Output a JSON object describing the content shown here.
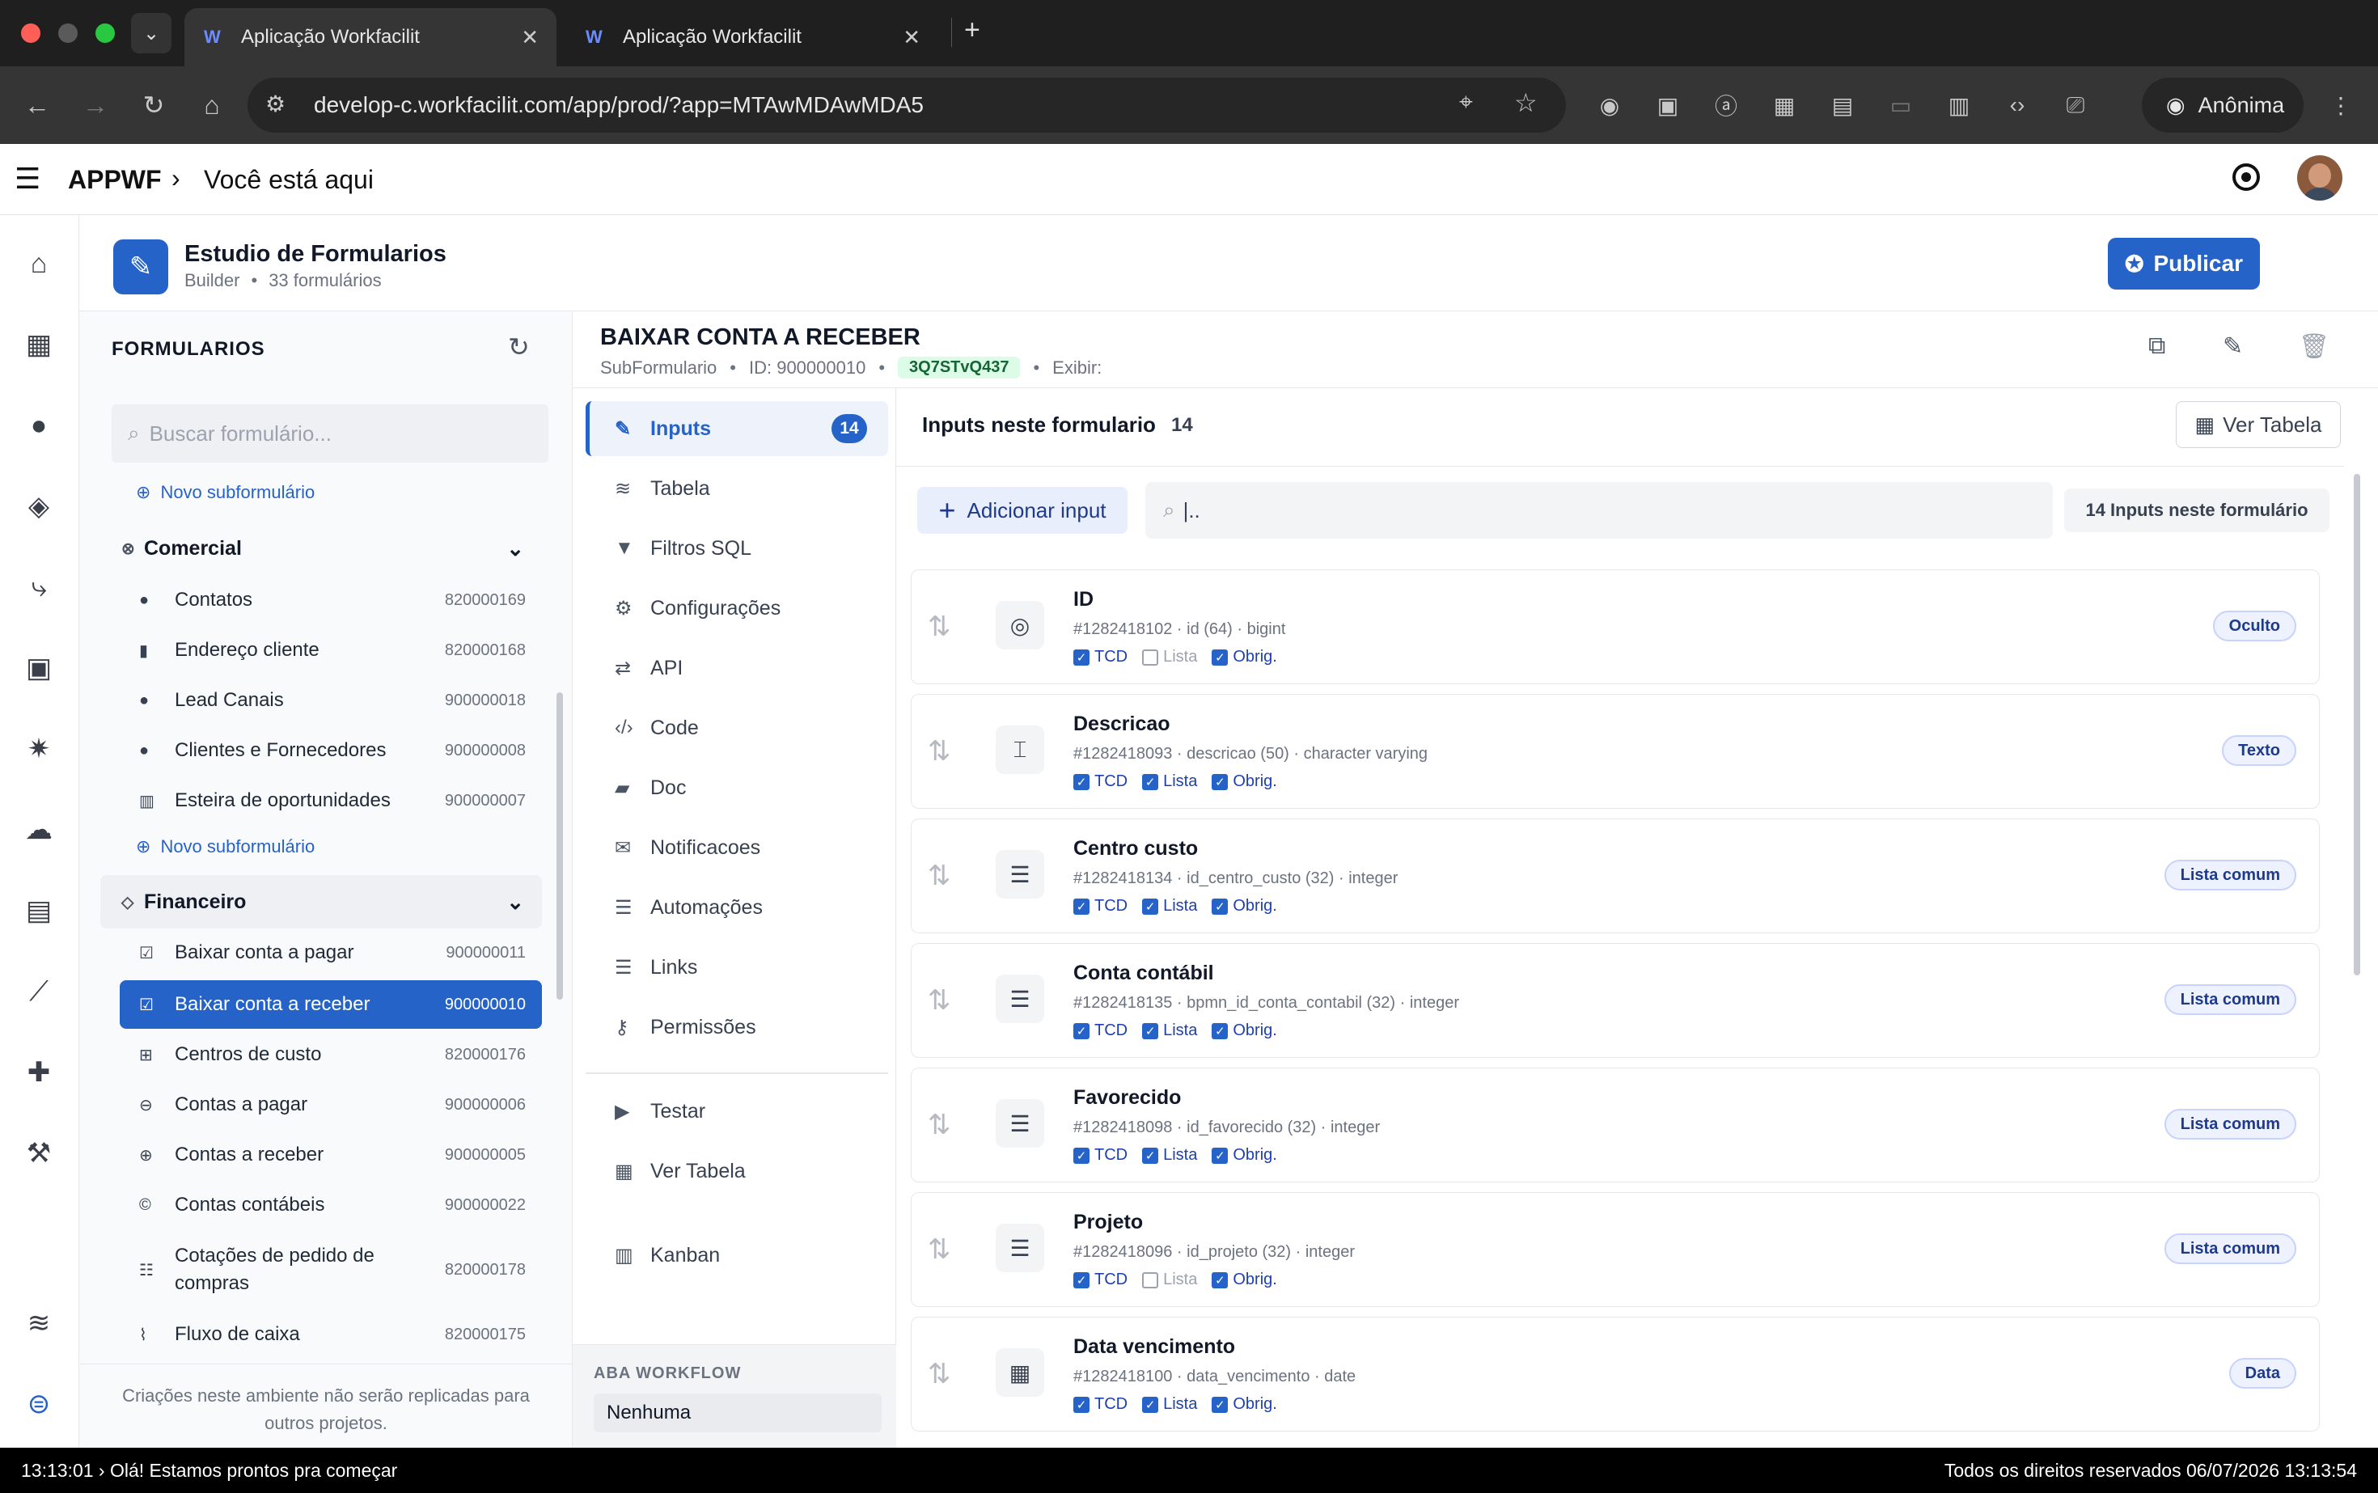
{
  "browser": {
    "tabs": [
      {
        "title": "Aplicação Workfacilit",
        "active": true
      },
      {
        "title": "Aplicação Workfacilit",
        "active": false
      }
    ],
    "url": "develop-c.workfacilit.com/app/prod/?app=MTAwMDAwMDA5",
    "profile": "Anônima"
  },
  "header": {
    "app_name": "APPWF",
    "breadcrumb": "Você está aqui"
  },
  "studio": {
    "title": "Estudio de Formularios",
    "subtitle_type": "Builder",
    "subtitle_count": "33 formulários",
    "publish_label": "Publicar"
  },
  "forms_panel": {
    "heading": "FORMULARIOS",
    "search_placeholder": "Buscar formulário...",
    "new_sub_label": "Novo subformulário",
    "groups": [
      {
        "name": "Comercial",
        "items": [
          {
            "label": "Contatos",
            "id": "820000169"
          },
          {
            "label": "Endereço cliente",
            "id": "820000168"
          },
          {
            "label": "Lead Canais",
            "id": "900000018"
          },
          {
            "label": "Clientes e Fornecedores",
            "id": "900000008"
          },
          {
            "label": "Esteira de oportunidades",
            "id": "900000007"
          }
        ],
        "new_sub_label": "Novo subformulário"
      },
      {
        "name": "Financeiro",
        "items": [
          {
            "label": "Baixar conta a pagar",
            "id": "900000011"
          },
          {
            "label": "Baixar conta a receber",
            "id": "900000010"
          },
          {
            "label": "Centros de custo",
            "id": "820000176"
          },
          {
            "label": "Contas a pagar",
            "id": "900000006"
          },
          {
            "label": "Contas a receber",
            "id": "900000005"
          },
          {
            "label": "Contas contábeis",
            "id": "900000022"
          },
          {
            "label": "Cotações de pedido de compras",
            "id": "820000178"
          },
          {
            "label": "Fluxo de caixa",
            "id": "820000175"
          }
        ]
      }
    ],
    "footer_note": "Criações neste ambiente não serão replicadas para outros projetos."
  },
  "detail": {
    "title": "BAIXAR CONTA A RECEBER",
    "kind": "SubFormulario",
    "id_label": "ID: 900000010",
    "hash": "3Q7STvQ437",
    "exibir_label": "Exibir:"
  },
  "menu": {
    "items": [
      {
        "label": "Inputs",
        "badge": "14",
        "icon": "edit-icon"
      },
      {
        "label": "Tabela",
        "icon": "database-icon"
      },
      {
        "label": "Filtros SQL",
        "icon": "filter-icon"
      },
      {
        "label": "Configurações",
        "icon": "gear-icon"
      },
      {
        "label": "API",
        "icon": "swap-icon"
      },
      {
        "label": "Code",
        "icon": "code-icon"
      },
      {
        "label": "Doc",
        "icon": "book-icon"
      },
      {
        "label": "Notificacoes",
        "icon": "mail-icon"
      },
      {
        "label": "Automações",
        "icon": "list-icon"
      },
      {
        "label": "Links",
        "icon": "list-icon"
      },
      {
        "label": "Permissões",
        "icon": "key-icon"
      }
    ],
    "extra": [
      {
        "label": "Testar",
        "icon": "play-icon"
      },
      {
        "label": "Ver Tabela",
        "icon": "table-icon"
      },
      {
        "label": "Kanban",
        "icon": "kanban-icon"
      }
    ],
    "workflow_heading": "ABA WORKFLOW",
    "workflow_value": "Nenhuma"
  },
  "inputs": {
    "heading": "Inputs neste formulario",
    "count": "14",
    "ver_tabela": "Ver Tabela",
    "add_label": "Adicionar input",
    "search_value": "|..",
    "count_badge": "14 Inputs neste formulário",
    "rows": [
      {
        "name": "ID",
        "meta": "#1282418102 · id (64) · bigint",
        "tcd": true,
        "lista": false,
        "obrig": true,
        "type": "Oculto",
        "icon": "eye-off-icon",
        "glyph": "◎"
      },
      {
        "name": "Descricao",
        "meta": "#1282418093 · descricao (50) · character varying",
        "tcd": true,
        "lista": true,
        "obrig": true,
        "type": "Texto",
        "icon": "text-field-icon",
        "glyph": "⌶"
      },
      {
        "name": "Centro custo",
        "meta": "#1282418134 · id_centro_custo (32) · integer",
        "tcd": true,
        "lista": true,
        "obrig": true,
        "type": "Lista comum",
        "icon": "list-icon",
        "glyph": "☰"
      },
      {
        "name": "Conta contábil",
        "meta": "#1282418135 · bpmn_id_conta_contabil (32) · integer",
        "tcd": true,
        "lista": true,
        "obrig": true,
        "type": "Lista comum",
        "icon": "list-icon",
        "glyph": "☰"
      },
      {
        "name": "Favorecido",
        "meta": "#1282418098 · id_favorecido (32) · integer",
        "tcd": true,
        "lista": true,
        "obrig": true,
        "type": "Lista comum",
        "icon": "list-icon",
        "glyph": "☰"
      },
      {
        "name": "Projeto",
        "meta": "#1282418096 · id_projeto (32) · integer",
        "tcd": true,
        "lista": false,
        "obrig": true,
        "type": "Lista comum",
        "icon": "list-icon",
        "glyph": "☰"
      },
      {
        "name": "Data vencimento",
        "meta": "#1282418100 · data_vencimento · date",
        "tcd": true,
        "lista": true,
        "obrig": true,
        "type": "Data",
        "icon": "calendar-icon",
        "glyph": "▦"
      }
    ],
    "flag_labels": {
      "tcd": "TCD",
      "lista": "Lista",
      "obrig": "Obrig."
    }
  },
  "status_bar": {
    "left": "13:13:01 › Olá! Estamos prontos pra começar",
    "right": "Todos os direitos reservados 06/07/2026 13:13:54"
  },
  "colors": {
    "accent": "#2563c9",
    "badge_bg": "#eef2ff",
    "hash_bg": "#dcfce7"
  }
}
